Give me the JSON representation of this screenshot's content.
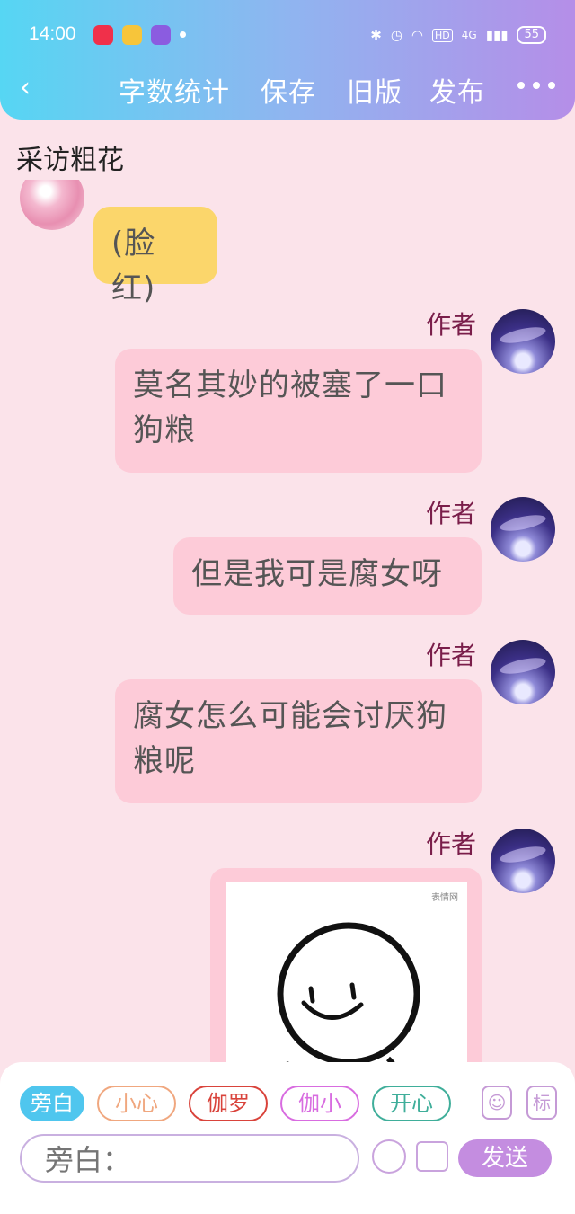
{
  "status_bar": {
    "time": "14:00",
    "network": "4G",
    "hd": "HD",
    "battery": "55"
  },
  "nav": {
    "back_icon": "chevron-left-icon",
    "word_count": "字数统计",
    "save": "保存",
    "old_version": "旧版",
    "publish": "发布",
    "more_icon": "more-dots-icon"
  },
  "page_title": "采访粗花",
  "messages": [
    {
      "sender": "",
      "side": "left",
      "text": "(脸红)",
      "style": "yellow"
    },
    {
      "sender": "作者",
      "side": "right",
      "text": "莫名其妙的被塞了一口狗粮"
    },
    {
      "sender": "作者",
      "side": "right",
      "text": "但是我可是腐女呀"
    },
    {
      "sender": "作者",
      "side": "right",
      "text": "腐女怎么可能会讨厌狗粮呢"
    },
    {
      "sender": "作者",
      "side": "right",
      "image_watermark": "表情网"
    }
  ],
  "toolbar": {
    "chips": [
      {
        "label": "旁白",
        "active": true,
        "color": "#4fc6ee"
      },
      {
        "label": "小心",
        "active": false,
        "color": "#f0a77f"
      },
      {
        "label": "伽罗",
        "active": false,
        "color": "#d9433b"
      },
      {
        "label": "伽小",
        "active": false,
        "color": "#d86ce0"
      },
      {
        "label": "开心",
        "active": false,
        "color": "#3fae9a"
      }
    ],
    "tag_button": "标",
    "input_placeholder": "旁白：",
    "send": "发送"
  }
}
